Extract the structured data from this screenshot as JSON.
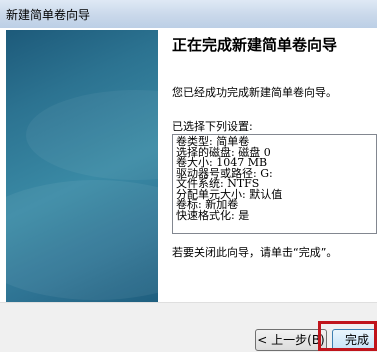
{
  "window": {
    "title": "新建简单卷向导"
  },
  "page": {
    "heading": "正在完成新建简单卷向导",
    "description": "您已经成功完成新建简单卷向导。",
    "settings_label": "已选择下列设置:",
    "settings": [
      "卷类型: 简单卷",
      "选择的磁盘: 磁盘 0",
      "卷大小: 1047 MB",
      "驱动器号或路径: G:",
      "文件系统: NTFS",
      "分配单元大小: 默认值",
      "卷标: 新加卷",
      "快速格式化: 是"
    ],
    "closing": "若要关闭此向导，请单击“完成”。"
  },
  "footer": {
    "back_label": "< 上一步(B)",
    "finish_label": "完成"
  }
}
